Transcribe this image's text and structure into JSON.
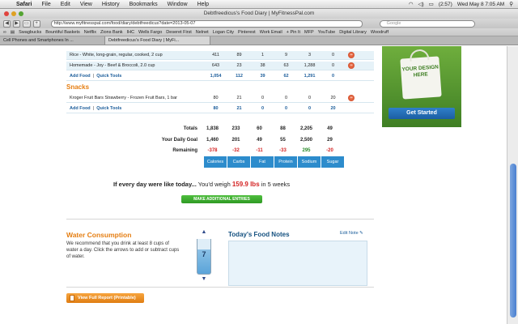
{
  "menubar": {
    "app": "Safari",
    "items": [
      "File",
      "Edit",
      "View",
      "History",
      "Bookmarks",
      "Window",
      "Help"
    ],
    "battery": "(2:57)",
    "clock": "Wed May 8  7:05 AM"
  },
  "window": {
    "title": "Debtfreedicus's Food Diary | MyFitnessPal.com"
  },
  "toolbar": {
    "url": "http://www.myfitnesspal.com/food/diary/debtfreedicus?date=2013-05-07",
    "search_placeholder": "Google",
    "back_label": "◀",
    "forward_label": "▶",
    "add_label": "+"
  },
  "bookmarks": [
    "Swagbucks",
    "Bountiful Baskets",
    "Netflix",
    "Zions Bank",
    "IHC",
    "Wells Fargo",
    "Deseret First",
    "Nelnet",
    "Logan City",
    "Pinterest",
    "Work Email",
    "+ Pin It",
    "MFP",
    "YouTube",
    "Digital Library",
    "Woodruff"
  ],
  "tabs": [
    {
      "label": "Cell Phones and Smartphones In ..."
    },
    {
      "label": "Debtfreedicus's Food Diary | MyFi..."
    }
  ],
  "diary": {
    "foods_top": [
      {
        "name": "Rice - White, long-grain, regular, cooked, 2 cup",
        "values": [
          "411",
          "89",
          "1",
          "9",
          "3",
          "0"
        ]
      },
      {
        "name": "Homemade - Joy - Beef & Broccoli, 2.0 cup",
        "values": [
          "643",
          "23",
          "38",
          "63",
          "1,288",
          "0"
        ]
      }
    ],
    "add_food_label": "Add Food",
    "quick_tools_label": "Quick Tools",
    "meal1_totals": [
      "1,054",
      "112",
      "39",
      "62",
      "1,291",
      "0"
    ],
    "snacks_title": "Snacks",
    "snacks": [
      {
        "name": "Kroger Fruit Bars Strawberry - Frozen Fruit Bars, 1 bar",
        "values": [
          "80",
          "21",
          "0",
          "0",
          "0",
          "20"
        ]
      }
    ],
    "snacks_totals": [
      "80",
      "21",
      "0",
      "0",
      "0",
      "20"
    ],
    "totals_label": "Totals",
    "totals": [
      "1,838",
      "233",
      "60",
      "88",
      "2,205",
      "49"
    ],
    "goal_label": "Your Daily Goal",
    "goal": [
      "1,460",
      "201",
      "49",
      "55",
      "2,500",
      "29"
    ],
    "remaining_label": "Remaining",
    "remaining": [
      "-378",
      "-32",
      "-11",
      "-33",
      "295",
      "-20"
    ],
    "columns": [
      "Calories",
      "Carbs",
      "Fat",
      "Protein",
      "Sodium",
      "Sugar"
    ]
  },
  "projection": {
    "prefix": "If every day were like today...",
    "middle": "You'd weigh",
    "weight": "159.9 lbs",
    "suffix": "in 5 weeks",
    "make_entries": "MAKE ADDITIONAL ENTRIES"
  },
  "water": {
    "title": "Water Consumption",
    "text": "We recommend that you drink at least 8 cups of water a day. Click the arrows to add or subtract cups of water.",
    "cups": "7"
  },
  "notes": {
    "title": "Today's Food Notes",
    "edit_label": "Edit Note"
  },
  "report_button": "View Full Report (Printable)",
  "ad": {
    "bag_text": "YOUR DESIGN HERE",
    "cta": "Get Started"
  },
  "colors": {
    "accent_orange": "#e57e12",
    "header_blue": "#2d8ccc",
    "negative_red": "#d42323",
    "positive_green": "#2a8a2a"
  }
}
